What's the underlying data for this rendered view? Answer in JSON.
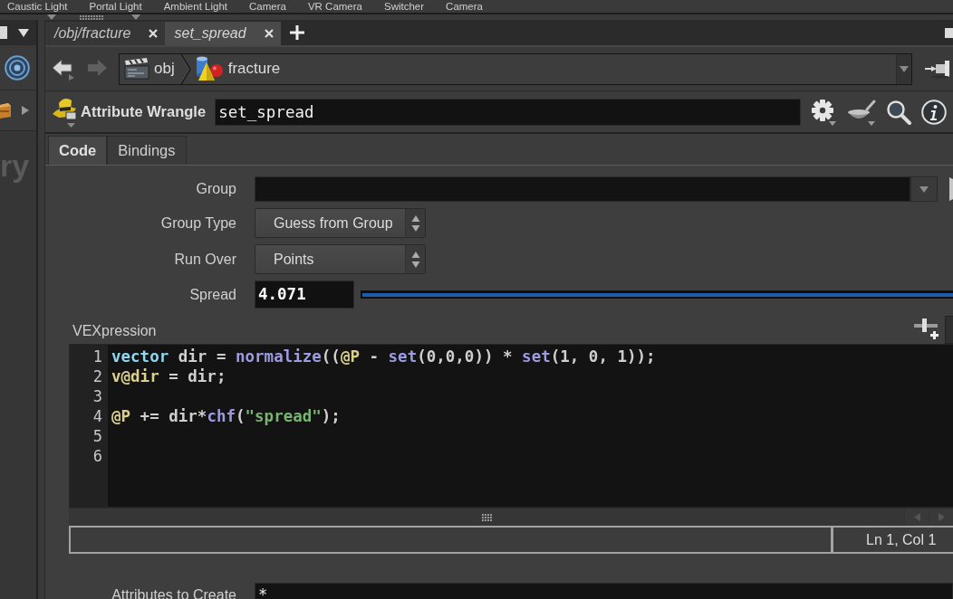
{
  "shelf": {
    "labels": [
      "Caustic Light",
      "Portal Light",
      "Ambient Light",
      "Camera",
      "VR Camera",
      "Switcher",
      "Camera"
    ]
  },
  "left_panel": {
    "label": "ry"
  },
  "editor_tabs": [
    {
      "label": "/obj/fracture",
      "selected": false
    },
    {
      "label": "set_spread",
      "selected": true
    }
  ],
  "path_bar": {
    "items": [
      {
        "label": "obj",
        "kind": "network"
      },
      {
        "label": "fracture",
        "kind": "geometry"
      }
    ]
  },
  "node": {
    "type_label": "Attribute Wrangle",
    "name": "set_spread"
  },
  "parm_tabs": [
    {
      "label": "Code",
      "selected": true
    },
    {
      "label": "Bindings",
      "selected": false
    }
  ],
  "parameters": [
    {
      "kind": "field",
      "label": "Group"
    },
    {
      "kind": "menu",
      "label": "Group Type",
      "value": "Guess from Group"
    },
    {
      "kind": "menu",
      "label": "Run Over",
      "value": "Points"
    },
    {
      "kind": "slider",
      "label": "Spread",
      "value": "4.071",
      "level": 1
    }
  ],
  "vexpression": {
    "label": "VEXpression",
    "lines": [
      {
        "number": "1",
        "tokens": [
          {
            "text": "vector",
            "kind": "keyword"
          },
          {
            "text": " dir = ",
            "kind": "plain"
          },
          {
            "text": "normalize",
            "kind": "function"
          },
          {
            "text": "((",
            "kind": "plain"
          },
          {
            "text": "@P",
            "kind": "attribute"
          },
          {
            "text": " - ",
            "kind": "plain"
          },
          {
            "text": "set",
            "kind": "function"
          },
          {
            "text": "(0,0,0)) * ",
            "kind": "plain"
          },
          {
            "text": "set",
            "kind": "function"
          },
          {
            "text": "(1, 0, 1));",
            "kind": "plain"
          }
        ]
      },
      {
        "number": "2",
        "tokens": [
          {
            "text": "v@dir",
            "kind": "attribute"
          },
          {
            "text": " = dir;",
            "kind": "plain"
          }
        ]
      },
      {
        "number": "3"
      },
      {
        "number": "4",
        "tokens": [
          {
            "text": "@P",
            "kind": "attribute"
          },
          {
            "text": " += dir*",
            "kind": "plain"
          },
          {
            "text": "chf",
            "kind": "function"
          },
          {
            "text": "(",
            "kind": "plain"
          },
          {
            "text": "\"spread\"",
            "kind": "string"
          },
          {
            "text": ");",
            "kind": "plain"
          }
        ]
      },
      {
        "number": "5"
      },
      {
        "number": "6"
      }
    ],
    "cursor_position": "Ln 1, Col 1"
  },
  "attributes_to_create": {
    "label": "Attributes to Create",
    "value": "*"
  }
}
